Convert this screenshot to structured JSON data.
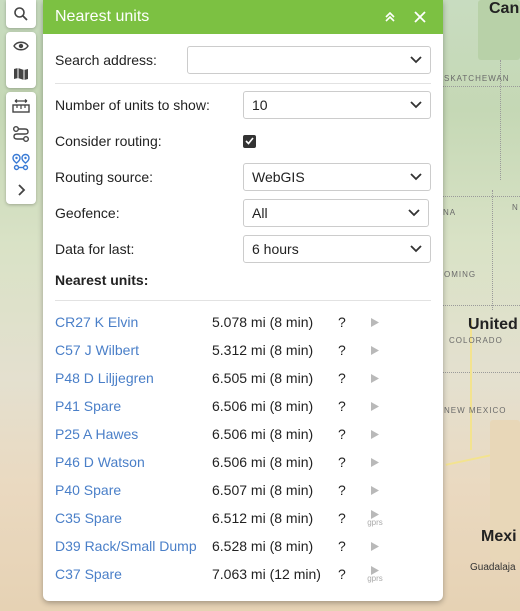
{
  "map": {
    "labels": {
      "cana": "Can",
      "saskatchewan": "SKATCHEWAN",
      "na": "NA",
      "nd": "N",
      "wyoming": "OMING",
      "united": "United",
      "colorado": "COLORADO",
      "new_mexico": "NEW MEXICO",
      "mexico": "Mexi",
      "guadalajara": "Guadalaja"
    }
  },
  "toolbar": {
    "icons": [
      "search-icon",
      "eye-icon",
      "map-icon",
      "ruler-icon",
      "route-icon",
      "nearest-units-icon",
      "chevron-right-icon"
    ]
  },
  "panel": {
    "title": "Nearest units",
    "colors": {
      "header": "#7cc142",
      "link": "#4a7fc8"
    },
    "search": {
      "label": "Search address:",
      "value": ""
    },
    "units_to_show": {
      "label": "Number of units to show:",
      "value": "10"
    },
    "routing": {
      "label": "Consider routing:",
      "checked": true
    },
    "routing_source": {
      "label": "Routing source:",
      "value": "WebGIS"
    },
    "geofence": {
      "label": "Geofence:",
      "value": "All"
    },
    "data_for_last": {
      "label": "Data for last:",
      "value": "6 hours"
    },
    "nearest_title": "Nearest units:",
    "units": [
      {
        "name": "CR27 K Elvin",
        "dist": "5.078 mi (8 min)",
        "q": "?",
        "gprs": ""
      },
      {
        "name": "C57 J Wilbert",
        "dist": "5.312 mi (8 min)",
        "q": "?",
        "gprs": ""
      },
      {
        "name": "P48 D Liljjegren",
        "dist": "6.505 mi (8 min)",
        "q": "?",
        "gprs": ""
      },
      {
        "name": "P41 Spare",
        "dist": "6.506 mi (8 min)",
        "q": "?",
        "gprs": ""
      },
      {
        "name": "P25 A Hawes",
        "dist": "6.506 mi (8 min)",
        "q": "?",
        "gprs": ""
      },
      {
        "name": "P46 D Watson",
        "dist": "6.506 mi (8 min)",
        "q": "?",
        "gprs": ""
      },
      {
        "name": "P40 Spare",
        "dist": "6.507 mi (8 min)",
        "q": "?",
        "gprs": ""
      },
      {
        "name": "C35 Spare",
        "dist": "6.512 mi (8 min)",
        "q": "?",
        "gprs": "gprs"
      },
      {
        "name": "D39 Rack/Small Dump",
        "dist": "6.528 mi (8 min)",
        "q": "?",
        "gprs": ""
      },
      {
        "name": "C37 Spare",
        "dist": "7.063 mi (12 min)",
        "q": "?",
        "gprs": "gprs"
      }
    ]
  }
}
